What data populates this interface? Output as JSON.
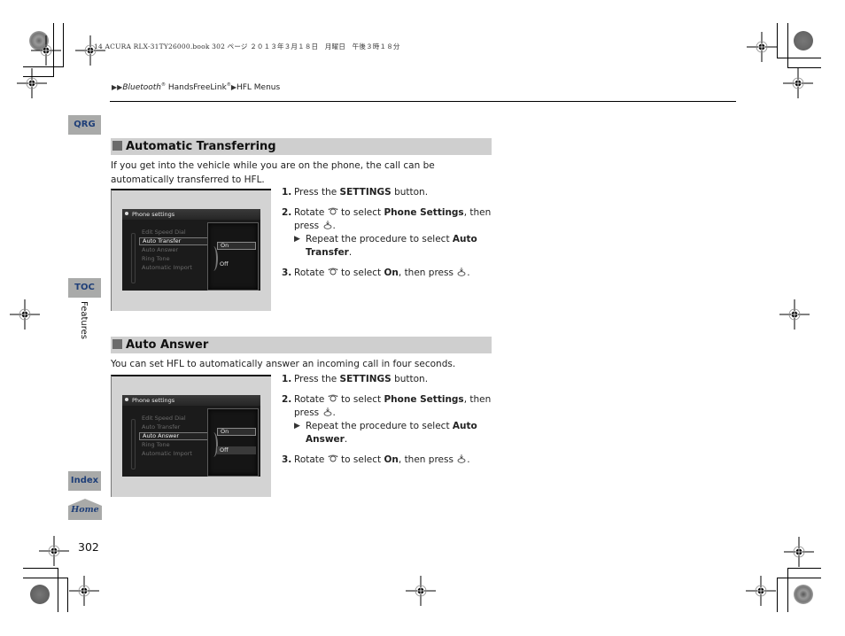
{
  "print_header": "14 ACURA RLX-31TY26000.book  302 ページ  ２０１３年３月１８日　月曜日　午後３時１８分",
  "breadcrumb": {
    "items": [
      "Bluetooth",
      "HandsFreeLink",
      "HFL Menus"
    ],
    "registered_mark": "®"
  },
  "side_nav": {
    "qrg": "QRG",
    "toc": "TOC",
    "section_label": "Features",
    "index": "Index",
    "home": "Home"
  },
  "page_number": "302",
  "sections": [
    {
      "title": "Automatic Transferring",
      "intro": "If you get into the vehicle while you are on the phone, the call can be automatically transferred to HFL.",
      "screen": {
        "title": "Phone settings",
        "menu_items": [
          "Edit Speed Dial",
          "Auto Transfer",
          "Auto Answer",
          "Ring Tone",
          "Automatic Import"
        ],
        "selected_index": 1,
        "options": [
          "On",
          "Off"
        ],
        "selected_option": "On"
      },
      "steps": {
        "s1_num": "1.",
        "s1_pre": "Press the ",
        "s1_bold": "SETTINGS",
        "s1_post": " button.",
        "s2_num": "2.",
        "s2_pre": "Rotate ",
        "s2_mid": " to select ",
        "s2_bold": "Phone Settings",
        "s2_post": ", then press ",
        "s2_end": ".",
        "sub_pre": "Repeat the procedure to select ",
        "sub_bold": "Auto Transfer",
        "sub_end": ".",
        "s3_num": "3.",
        "s3_pre": "Rotate ",
        "s3_mid": " to select ",
        "s3_bold": "On",
        "s3_post": ", then press ",
        "s3_end": "."
      }
    },
    {
      "title": "Auto Answer",
      "intro": "You can set HFL to automatically answer an incoming call in four seconds.",
      "screen": {
        "title": "Phone settings",
        "menu_items": [
          "Edit Speed Dial",
          "Auto Transfer",
          "Auto Answer",
          "Ring Tone",
          "Automatic Import"
        ],
        "selected_index": 2,
        "options": [
          "On",
          "Off"
        ],
        "selected_option": "On"
      },
      "steps": {
        "s1_num": "1.",
        "s1_pre": "Press the ",
        "s1_bold": "SETTINGS",
        "s1_post": " button.",
        "s2_num": "2.",
        "s2_pre": "Rotate ",
        "s2_mid": " to select ",
        "s2_bold": "Phone Settings",
        "s2_post": ", then press ",
        "s2_end": ".",
        "sub_pre": "Repeat the procedure to select ",
        "sub_bold": "Auto Answer",
        "sub_end": ".",
        "s3_num": "3.",
        "s3_pre": "Rotate ",
        "s3_mid": " to select ",
        "s3_bold": "On",
        "s3_post": ", then press ",
        "s3_end": "."
      }
    }
  ],
  "colors": {
    "nav_tab_bg": "#a9aaa9",
    "nav_tab_text": "#1f3f78",
    "section_bar": "#cfcfcf",
    "section_square": "#6b6b6b"
  }
}
